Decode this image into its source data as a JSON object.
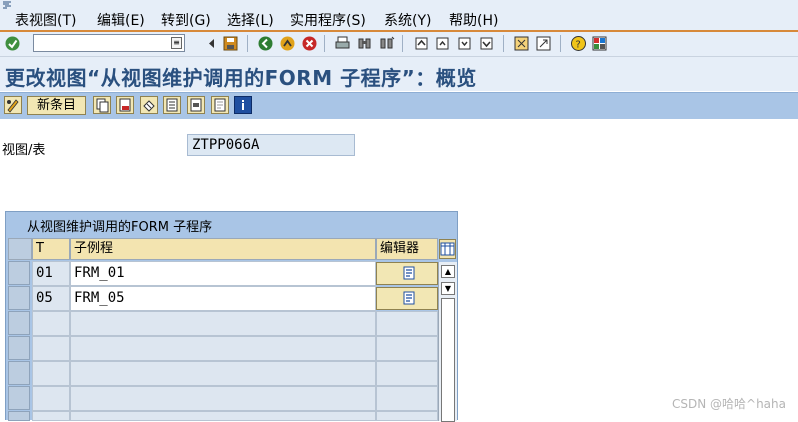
{
  "menu": {
    "items": [
      "表视图(T)",
      "编辑(E)",
      "转到(G)",
      "选择(L)",
      "实用程序(S)",
      "系统(Y)",
      "帮助(H)"
    ]
  },
  "toolbar": {
    "command_value": ""
  },
  "title": "更改视图“从视图维护调用的FORM 子程序”：概览",
  "app_toolbar": {
    "new_entries_label": "新条目"
  },
  "fields": {
    "view_label": "视图/表",
    "view_value": "ZTPP066A"
  },
  "table": {
    "title": "从视图维护调用的FORM 子程序",
    "columns": [
      "T",
      "子例程",
      "编辑器"
    ],
    "rows": [
      {
        "t": "01",
        "routine": "FRM_01"
      },
      {
        "t": "05",
        "routine": "FRM_05"
      }
    ]
  },
  "watermark": "CSDN @哈哈^haha",
  "colors": {
    "title": "#2a507f",
    "menu_bg": "#e6eef8",
    "app_toolbar_bg": "#a9c5e6",
    "button_bg": "#f2e7b4",
    "header_bg": "#f3e4b0"
  }
}
